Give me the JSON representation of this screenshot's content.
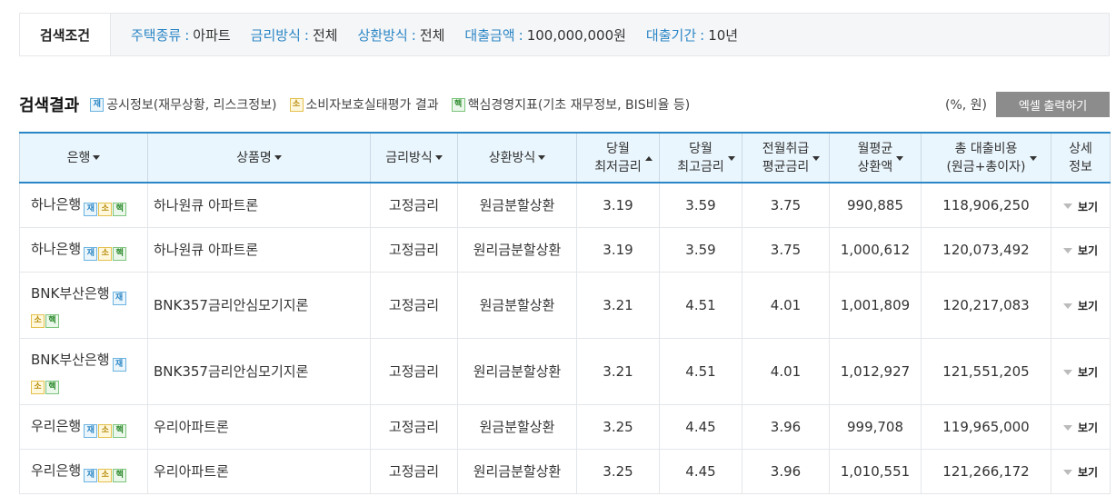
{
  "search": {
    "title": "검색조건",
    "conditions": [
      {
        "label": "주택종류",
        "value": "아파트"
      },
      {
        "label": "금리방식",
        "value": "전체"
      },
      {
        "label": "상환방식",
        "value": "전체"
      },
      {
        "label": "대출금액",
        "value": "100,000,000원"
      },
      {
        "label": "대출기간",
        "value": "10년"
      }
    ],
    "separator": ":"
  },
  "results": {
    "title": "검색결과",
    "legends": [
      {
        "badge": "재",
        "text": "공시정보(재무상황, 리스크정보)"
      },
      {
        "badge": "소",
        "text": "소비자보호실태평가 결과"
      },
      {
        "badge": "핵",
        "text": "핵심경영지표(기초 재무정보, BIS비율 등)"
      }
    ],
    "unit": "(%, 원)",
    "excel_label": "엑셀 출력하기"
  },
  "table": {
    "headers": {
      "bank": "은행",
      "product": "상품명",
      "rate_type": "금리방식",
      "repay_type": "상환방식",
      "min_rate_1": "당월",
      "min_rate_2": "최저금리",
      "max_rate_1": "당월",
      "max_rate_2": "최고금리",
      "avg_rate_1": "전월취급",
      "avg_rate_2": "평균금리",
      "monthly_1": "월평균",
      "monthly_2": "상환액",
      "total_1": "총 대출비용",
      "total_2": "(원금+총이자)",
      "detail_1": "상세",
      "detail_2": "정보"
    },
    "badges": {
      "jae": "재",
      "so": "소",
      "haek": "핵"
    },
    "view_label": "보기",
    "rows": [
      {
        "bank": "하나은행",
        "product": "하나원큐 아파트론",
        "rate_type": "고정금리",
        "repay_type": "원금분할상환",
        "min_rate": "3.19",
        "max_rate": "3.59",
        "avg_rate": "3.75",
        "monthly": "990,885",
        "total": "118,906,250"
      },
      {
        "bank": "하나은행",
        "product": "하나원큐 아파트론",
        "rate_type": "고정금리",
        "repay_type": "원리금분할상환",
        "min_rate": "3.19",
        "max_rate": "3.59",
        "avg_rate": "3.75",
        "monthly": "1,000,612",
        "total": "120,073,492"
      },
      {
        "bank": "BNK부산은행",
        "product": "BNK357금리안심모기지론",
        "rate_type": "고정금리",
        "repay_type": "원금분할상환",
        "min_rate": "3.21",
        "max_rate": "4.51",
        "avg_rate": "4.01",
        "monthly": "1,001,809",
        "total": "120,217,083"
      },
      {
        "bank": "BNK부산은행",
        "product": "BNK357금리안심모기지론",
        "rate_type": "고정금리",
        "repay_type": "원리금분할상환",
        "min_rate": "3.21",
        "max_rate": "4.51",
        "avg_rate": "4.01",
        "monthly": "1,012,927",
        "total": "121,551,205"
      },
      {
        "bank": "우리은행",
        "product": "우리아파트론",
        "rate_type": "고정금리",
        "repay_type": "원금분할상환",
        "min_rate": "3.25",
        "max_rate": "4.45",
        "avg_rate": "3.96",
        "monthly": "999,708",
        "total": "119,965,000"
      },
      {
        "bank": "우리은행",
        "product": "우리아파트론",
        "rate_type": "고정금리",
        "repay_type": "원리금분할상환",
        "min_rate": "3.25",
        "max_rate": "4.45",
        "avg_rate": "3.96",
        "monthly": "1,010,551",
        "total": "121,266,172"
      }
    ]
  },
  "colors": {
    "accent": "#2b86c5",
    "header_bg": "#eaf6fd",
    "excel_btn": "#8c8c8c"
  }
}
